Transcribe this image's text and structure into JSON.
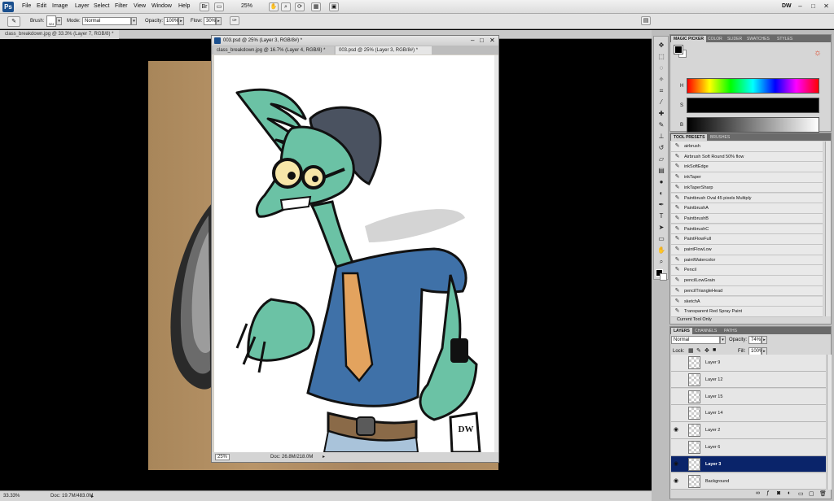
{
  "app": {
    "logo": "Ps",
    "workspace": "DW",
    "zoom": "25%"
  },
  "menu": [
    "File",
    "Edit",
    "Image",
    "Layer",
    "Select",
    "Filter",
    "View",
    "Window",
    "Help"
  ],
  "options": {
    "brush_label": "Brush:",
    "brush_size": "324",
    "mode_label": "Mode:",
    "mode_value": "Normal",
    "opacity_label": "Opacity:",
    "opacity_value": "100%",
    "flow_label": "Flow:",
    "flow_value": "30%"
  },
  "background_doc": {
    "tab_title": "class_breakdown.jpg @ 33.3% (Layer 7, RGB/8) *"
  },
  "doc_window": {
    "title": "003.psd @ 25% (Layer 3, RGB/8#) *",
    "tabs": [
      "class_breakdown.jpg @ 16.7% (Layer 4, RGB/8) *",
      "003.psd @ 25% (Layer 3, RGB/8#) *"
    ],
    "zoom": "25%",
    "doc_size": "Doc: 26.8M/218.0M"
  },
  "status": {
    "zoom": "33.33%",
    "doc_size": "Doc: 19.7M/483.0M"
  },
  "color_panel": {
    "tabs": [
      "MAGIC PICKER",
      "COLOR",
      "SLIDER",
      "SWATCHES",
      "STYLES"
    ],
    "hsb_labels": [
      "H",
      "S",
      "B"
    ]
  },
  "presets_panel": {
    "tabs": [
      "TOOL PRESETS",
      "BRUSHES"
    ],
    "items": [
      "airbrush",
      "Airbrush Soft Round 50% flow",
      "inkSoftEdge",
      "inkTaper",
      "inkTaperSharp",
      "Paintbrush Oval 45 pixels Multiply",
      "PaintbrushA",
      "PaintbrushB",
      "PaintbrushC",
      "PaintFlowFull",
      "paintFlowLow",
      "paintWatercolor",
      "Pencil",
      "pencilLowGrain",
      "pencilTriangleHead",
      "sketchA",
      "Transparent Red Spray Paint"
    ],
    "current_only": "Current Tool Only"
  },
  "layers_panel": {
    "tabs": [
      "LAYERS",
      "CHANNELS",
      "PATHS"
    ],
    "blend_mode": "Normal",
    "opacity_label": "Opacity:",
    "opacity_value": "74%",
    "lock_label": "Lock:",
    "fill_label": "Fill:",
    "fill_value": "100%",
    "layers": [
      {
        "name": "Layer 9",
        "visible": false,
        "selected": false
      },
      {
        "name": "Layer 12",
        "visible": false,
        "selected": false
      },
      {
        "name": "Layer 15",
        "visible": false,
        "selected": false
      },
      {
        "name": "Layer 14",
        "visible": false,
        "selected": false
      },
      {
        "name": "Layer 2",
        "visible": true,
        "selected": false
      },
      {
        "name": "Layer 6",
        "visible": false,
        "selected": false
      },
      {
        "name": "Layer 3",
        "visible": true,
        "selected": true
      },
      {
        "name": "Background",
        "visible": true,
        "selected": false
      }
    ]
  },
  "signature": "DW",
  "icons": {
    "tools": [
      "move-icon",
      "marquee-icon",
      "lasso-icon",
      "quick-select-icon",
      "crop-icon",
      "eyedropper-icon",
      "healing-icon",
      "brush-icon",
      "clone-stamp-icon",
      "history-brush-icon",
      "eraser-icon",
      "gradient-icon",
      "blur-icon",
      "dodge-icon",
      "pen-icon",
      "type-icon",
      "path-select-icon",
      "shape-icon",
      "hand-icon",
      "zoom-icon"
    ]
  }
}
